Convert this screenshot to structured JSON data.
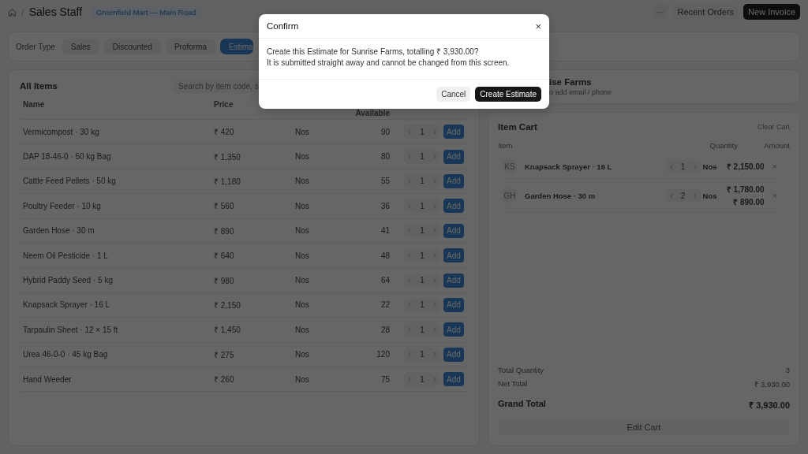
{
  "breadcrumb": {
    "separator": "/",
    "title": "Sales Staff",
    "store": "Greenfield Mart — Main Road"
  },
  "header_actions": {
    "more": "···",
    "recent": "Recent Orders",
    "new": "New Invoice"
  },
  "order_type": {
    "label": "Order Type",
    "options": [
      {
        "label": "Sales",
        "selected": false
      },
      {
        "label": "Discounted",
        "selected": false
      },
      {
        "label": "Proforma",
        "selected": false
      },
      {
        "label": "Estima",
        "selected": true
      }
    ]
  },
  "items": {
    "title": "All Items",
    "search": {
      "placeholder": "Search by item code, s"
    },
    "columns": [
      "Name",
      "Price",
      "Available"
    ],
    "rows": [
      {
        "name": "Vermicompost · 30 kg",
        "price": "₹ 420",
        "uom": "Nos",
        "available": "90",
        "qty": "1",
        "action": "Add"
      },
      {
        "name": "DAP 18-46-0 · 50 kg Bag",
        "price": "₹ 1,350",
        "uom": "Nos",
        "available": "80",
        "qty": "1",
        "action": "Add"
      },
      {
        "name": "Cattle Feed Pellets · 50 kg",
        "price": "₹ 1,180",
        "uom": "Nos",
        "available": "55",
        "qty": "1",
        "action": "Add"
      },
      {
        "name": "Poultry Feeder · 10 kg",
        "price": "₹ 560",
        "uom": "Nos",
        "available": "36",
        "qty": "1",
        "action": "Add"
      },
      {
        "name": "Garden Hose · 30 m",
        "price": "₹ 890",
        "uom": "Nos",
        "available": "41",
        "qty": "1",
        "action": "Add"
      },
      {
        "name": "Neem Oil Pesticide · 1 L",
        "price": "₹ 640",
        "uom": "Nos",
        "available": "48",
        "qty": "1",
        "action": "Add"
      },
      {
        "name": "Hybrid Paddy Seed · 5 kg",
        "price": "₹ 980",
        "uom": "Nos",
        "available": "64",
        "qty": "1",
        "action": "Add"
      },
      {
        "name": "Knapsack Sprayer · 16 L",
        "price": "₹ 2,150",
        "uom": "Nos",
        "available": "22",
        "qty": "1",
        "action": "Add"
      },
      {
        "name": "Tarpaulin Sheet · 12 × 15 ft",
        "price": "₹ 1,450",
        "uom": "Nos",
        "available": "28",
        "qty": "1",
        "action": "Add"
      },
      {
        "name": "Urea 46-0-0 · 45 kg Bag",
        "price": "₹ 275",
        "uom": "Nos",
        "available": "120",
        "qty": "1",
        "action": "Add"
      },
      {
        "name": "Hand Weeder",
        "price": "₹ 260",
        "uom": "Nos",
        "available": "75",
        "qty": "1",
        "action": "Add"
      }
    ]
  },
  "customer": {
    "name": "ise Farms",
    "hint": "o add email / phone"
  },
  "cart": {
    "title": "Item Cart",
    "clear": "Clear Cart",
    "columns": [
      "Item",
      "Quantity",
      "Amount"
    ],
    "lines": [
      {
        "initials": "KS",
        "name": "Knapsack Sprayer · 16 L",
        "qty": "1",
        "uom": "Nos",
        "amounts": [
          "₹ 2,150.00"
        ],
        "remove": "×"
      },
      {
        "initials": "GH",
        "name": "Garden Hose · 30 m",
        "qty": "2",
        "uom": "Nos",
        "amounts": [
          "₹ 1,780.00",
          "₹ 890.00"
        ],
        "remove": "×"
      }
    ],
    "totals": [
      {
        "label": "Total Quantity",
        "value": "3",
        "kind": "plain"
      },
      {
        "label": "Net Total",
        "value": "₹ 3,930.00",
        "kind": "plain"
      },
      {
        "label": "Grand Total",
        "value": "₹ 3,930.00",
        "kind": "grand"
      }
    ],
    "edit": "Edit Cart"
  },
  "dialog": {
    "title": "Confirm",
    "close": "×",
    "message": [
      "Create this Estimate for Sunrise Farms, totalling ₹ 3,930.00?",
      "It is submitted straight away and cannot be changed from this screen."
    ],
    "cancel": "Cancel",
    "confirm": "Create Estimate"
  }
}
